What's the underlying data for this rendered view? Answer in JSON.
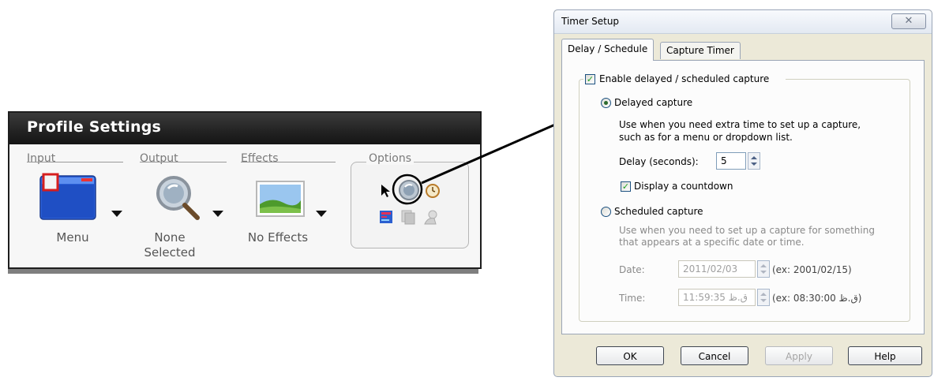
{
  "profile": {
    "title": "Profile Settings",
    "groups": {
      "input": "Input",
      "output": "Output",
      "effects": "Effects",
      "options": "Options"
    },
    "items": {
      "input": "Menu",
      "output_line1": "None",
      "output_line2": "Selected",
      "effects": "No Effects"
    }
  },
  "dialog": {
    "title": "Timer Setup",
    "close_label": "✕",
    "tabs": [
      "Delay / Schedule",
      "Capture Timer"
    ],
    "enable_label": "Enable delayed / scheduled capture",
    "delayed": {
      "label": "Delayed capture",
      "desc_line1": "Use when you need extra time to set up a capture,",
      "desc_line2": "such as for a menu or dropdown list.",
      "delay_label": "Delay (seconds):",
      "delay_value": "5",
      "countdown_label": "Display a countdown"
    },
    "scheduled": {
      "label": "Scheduled capture",
      "desc_line1": "Use when you need to set up a capture for something",
      "desc_line2": "that appears at a specific date or time.",
      "date_label": "Date:",
      "date_value": "2011/02/03",
      "date_example": "(ex: 2001/02/15)",
      "time_label": "Time:",
      "time_value": "11:59:35 ق.ظ",
      "time_example": "(ex: 08:30:00 ق.ظ)"
    },
    "buttons": {
      "ok": "OK",
      "cancel": "Cancel",
      "apply": "Apply",
      "help": "Help"
    }
  }
}
